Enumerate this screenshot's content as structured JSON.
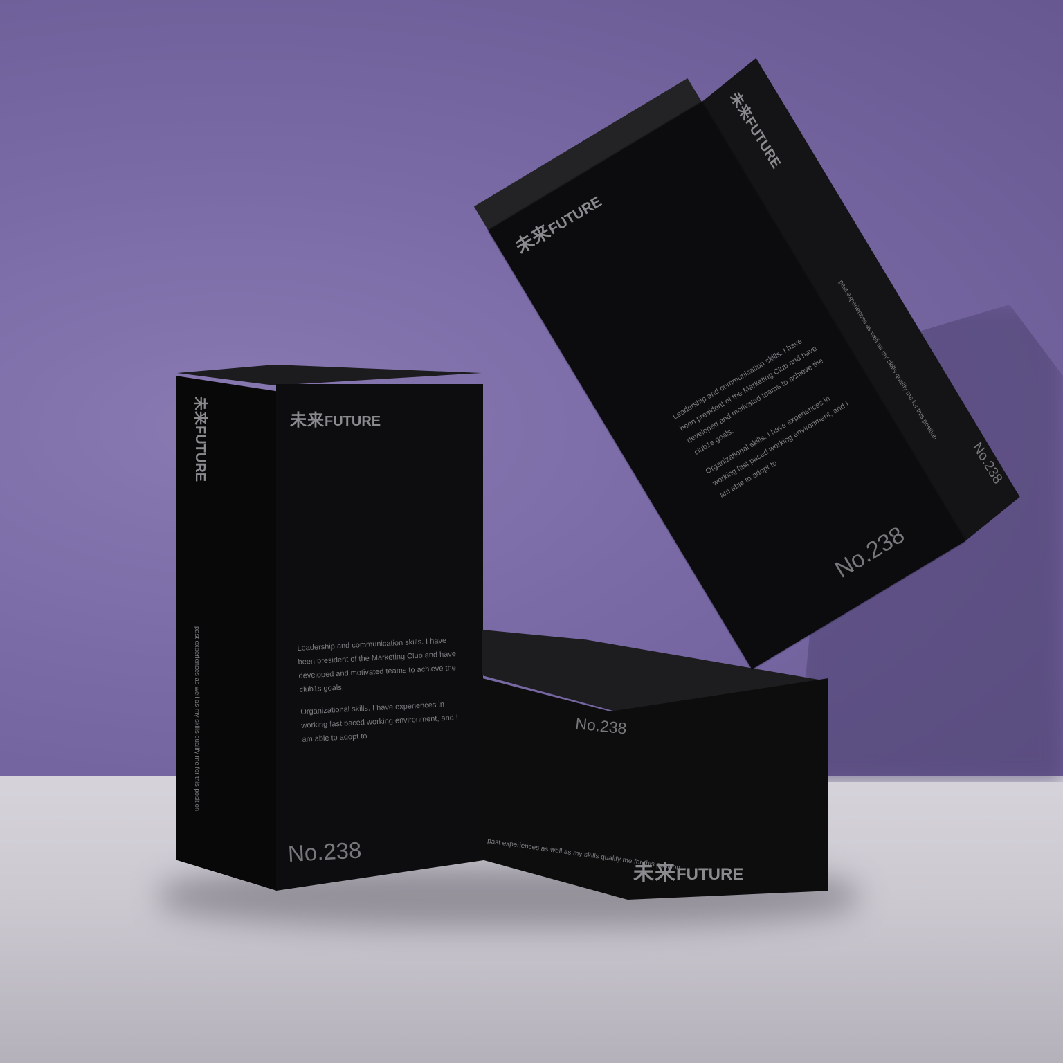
{
  "scene": {
    "description_colors": {
      "wall": "#7a6aa6",
      "floor": "#cbc8d0",
      "box": "#0d0d0f",
      "print": "#8b8b8f"
    }
  },
  "brand": {
    "cjk": "未来",
    "latin": "FUTURE"
  },
  "product_number": "No.238",
  "copy": {
    "paragraph_1": "Leadership and communication skills. I have been president of the Marketing Club and have developed and motivated teams to achieve the club1s goals.",
    "paragraph_2": "Organizational skills. I have experiences in working fast paced working environment, and I am able to adopt to",
    "side_line": "past experiences as well as my skills qualify me for this position"
  }
}
